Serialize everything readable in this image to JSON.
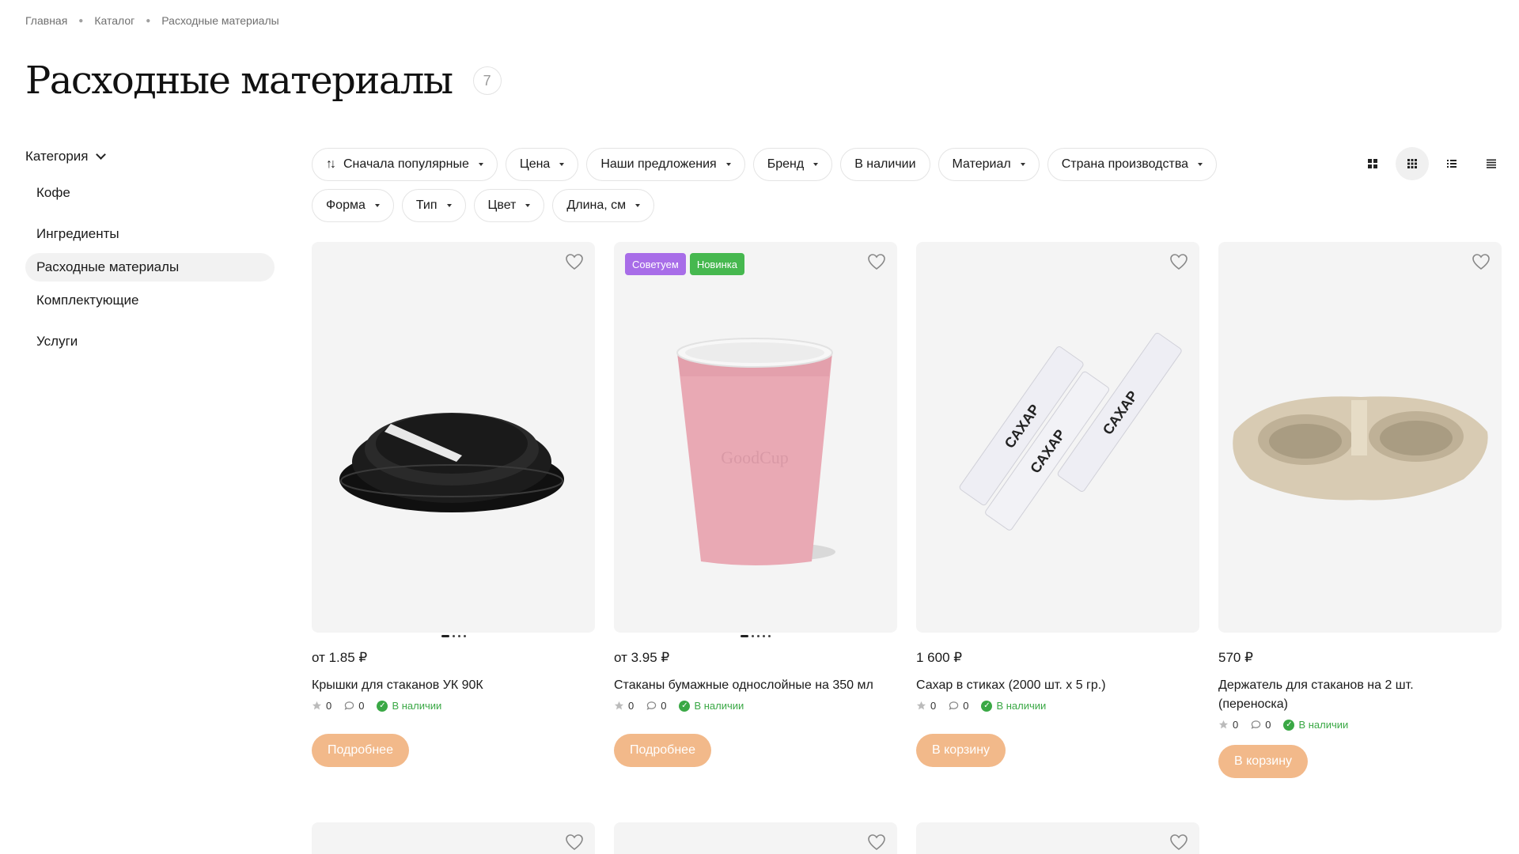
{
  "breadcrumb": [
    "Главная",
    "Каталог",
    "Расходные материалы"
  ],
  "page": {
    "title": "Расходные материалы",
    "count": "7"
  },
  "sidebar": {
    "toggle_label": "Категория",
    "items": [
      {
        "label": "Кофе",
        "active": false
      },
      {
        "label": "Ингредиенты",
        "active": false
      },
      {
        "label": "Расходные материалы",
        "active": true
      },
      {
        "label": "Комплектующие",
        "active": false
      },
      {
        "label": "Услуги",
        "active": false
      }
    ]
  },
  "filters": {
    "row1": [
      "Сначала популярные",
      "Цена",
      "Наши предложения",
      "Бренд",
      "В наличии",
      "Материал",
      "Страна производства"
    ],
    "row2": [
      "Форма",
      "Тип",
      "Цвет",
      "Длина, см"
    ]
  },
  "view_modes": [
    "grid-large-icon",
    "grid-small-icon",
    "list-icon",
    "compact-list-icon"
  ],
  "active_view": "grid-small-icon",
  "products": [
    {
      "price": "от 1.85 ₽",
      "name": "Крышки для стаканов УК 90К",
      "rating": "0",
      "reviews": "0",
      "stock": "В наличии",
      "button": "Подробнее",
      "badges": [],
      "image": "black-lid"
    },
    {
      "price": "от 3.95 ₽",
      "name": "Стаканы бумажные однослойные на 350 мл",
      "rating": "0",
      "reviews": "0",
      "stock": "В наличии",
      "button": "Подробнее",
      "badges": [
        "Советуем",
        "Новинка"
      ],
      "image": "pink-cup"
    },
    {
      "price": "1 600 ₽",
      "name": "Сахар в стиках (2000 шт. х 5 гр.)",
      "rating": "0",
      "reviews": "0",
      "stock": "В наличии",
      "button": "В корзину",
      "badges": [],
      "image": "sugar-sticks"
    },
    {
      "price": "570 ₽",
      "name": "Держатель для стаканов на 2 шт. (переноска)",
      "rating": "0",
      "reviews": "0",
      "stock": "В наличии",
      "button": "В корзину",
      "badges": [],
      "image": "cup-holder"
    }
  ],
  "colors": {
    "button": "#f2b98a",
    "stock": "#3aa845",
    "badge_recommend": "#a86de8",
    "badge_new": "#46b84f"
  }
}
